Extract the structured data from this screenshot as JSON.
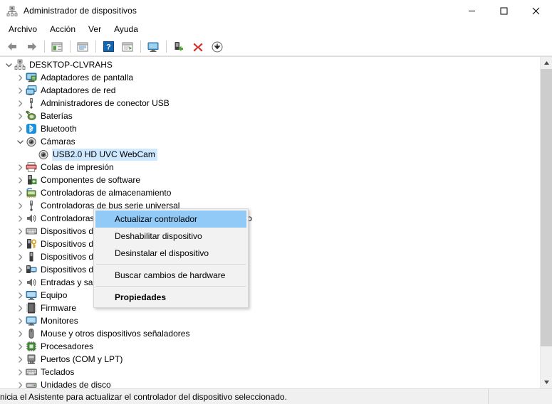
{
  "window": {
    "title": "Administrador de dispositivos",
    "icon": "device-manager-icon",
    "controls": {
      "minimize": "─",
      "maximize": "□",
      "close": "✕"
    }
  },
  "menubar": {
    "items": [
      {
        "label": "Archivo",
        "name": "menu-archivo"
      },
      {
        "label": "Acción",
        "name": "menu-accion"
      },
      {
        "label": "Ver",
        "name": "menu-ver"
      },
      {
        "label": "Ayuda",
        "name": "menu-ayuda"
      }
    ]
  },
  "toolbar": {
    "buttons": [
      {
        "icon": "back-arrow-icon",
        "glyph": "←"
      },
      {
        "icon": "forward-arrow-icon",
        "glyph": "→"
      },
      {
        "icon": "show-hide-console-tree-icon",
        "glyph": "▤"
      },
      {
        "icon": "properties-icon",
        "glyph": "▦"
      },
      {
        "icon": "help-icon",
        "glyph": "?"
      },
      {
        "icon": "update-driver-icon",
        "glyph": "▶"
      },
      {
        "icon": "scan-hardware-changes-icon",
        "glyph": "⬜"
      },
      {
        "icon": "enable-device-icon",
        "glyph": "↑"
      },
      {
        "icon": "uninstall-device-icon",
        "glyph": "✕"
      },
      {
        "icon": "install-legacy-hardware-icon",
        "glyph": "↓"
      }
    ]
  },
  "tree": {
    "root": {
      "label": "DESKTOP-CLVRAHS",
      "icon": "computer-icon",
      "expanded": true
    },
    "nodes": [
      {
        "label": "Adaptadores de pantalla",
        "icon": "display-adapter-icon",
        "expanded": false,
        "level": 1
      },
      {
        "label": "Adaptadores de red",
        "icon": "network-adapter-icon",
        "expanded": false,
        "level": 1
      },
      {
        "label": "Administradores de conector USB",
        "icon": "usb-connector-icon",
        "expanded": false,
        "level": 1
      },
      {
        "label": "Baterías",
        "icon": "battery-icon",
        "expanded": false,
        "level": 1
      },
      {
        "label": "Bluetooth",
        "icon": "bluetooth-icon",
        "expanded": false,
        "level": 1
      },
      {
        "label": "Cámaras",
        "icon": "camera-icon",
        "expanded": true,
        "level": 1
      },
      {
        "label": "USB2.0 HD UVC WebCam",
        "icon": "camera-device-icon",
        "expanded": null,
        "level": 2,
        "selected": true
      },
      {
        "label": "Colas de impresión",
        "icon": "print-queue-icon",
        "expanded": false,
        "level": 1
      },
      {
        "label": "Componentes de software",
        "icon": "software-component-icon",
        "expanded": false,
        "level": 1
      },
      {
        "label": "Controladoras de almacenamiento",
        "icon": "storage-controller-icon",
        "expanded": false,
        "level": 1
      },
      {
        "label": "Controladoras de bus serie universal",
        "icon": "usb-controller-icon",
        "expanded": false,
        "level": 1
      },
      {
        "label": "Controladoras de sonido y vídeo y dispositivos de juego",
        "icon": "sound-controller-icon",
        "expanded": false,
        "level": 1
      },
      {
        "label": "Dispositivos de interfaz de usuario",
        "icon": "hid-icon",
        "expanded": false,
        "level": 1
      },
      {
        "label": "Dispositivos de seguridad",
        "icon": "security-device-icon",
        "expanded": false,
        "level": 1
      },
      {
        "label": "Dispositivos de software",
        "icon": "software-device-icon",
        "expanded": false,
        "level": 1
      },
      {
        "label": "Dispositivos del sistema",
        "icon": "system-device-icon",
        "expanded": false,
        "level": 1
      },
      {
        "label": "Entradas y salidas de audio",
        "icon": "audio-io-icon",
        "expanded": false,
        "level": 1
      },
      {
        "label": "Equipo",
        "icon": "computer-device-icon",
        "expanded": false,
        "level": 1
      },
      {
        "label": "Firmware",
        "icon": "firmware-icon",
        "expanded": false,
        "level": 1
      },
      {
        "label": "Monitores",
        "icon": "monitor-icon",
        "expanded": false,
        "level": 1
      },
      {
        "label": "Mouse y otros dispositivos señaladores",
        "icon": "mouse-icon",
        "expanded": false,
        "level": 1
      },
      {
        "label": "Procesadores",
        "icon": "processor-icon",
        "expanded": false,
        "level": 1
      },
      {
        "label": "Puertos (COM y LPT)",
        "icon": "port-icon",
        "expanded": false,
        "level": 1
      },
      {
        "label": "Teclados",
        "icon": "keyboard-icon",
        "expanded": false,
        "level": 1
      },
      {
        "label": "Unidades de disco",
        "icon": "disk-drive-icon",
        "expanded": false,
        "level": 1
      }
    ]
  },
  "context_menu": {
    "items": [
      {
        "label": "Actualizar controlador",
        "name": "ctx-actualizar-controlador",
        "highlighted": true,
        "bold": false
      },
      {
        "label": "Deshabilitar dispositivo",
        "name": "ctx-deshabilitar-dispositivo",
        "highlighted": false,
        "bold": false
      },
      {
        "label": "Desinstalar el dispositivo",
        "name": "ctx-desinstalar-dispositivo",
        "highlighted": false,
        "bold": false
      },
      {
        "separator": true
      },
      {
        "label": "Buscar cambios de hardware",
        "name": "ctx-buscar-cambios-hardware",
        "highlighted": false,
        "bold": false
      },
      {
        "separator": true
      },
      {
        "label": "Propiedades",
        "name": "ctx-propiedades",
        "highlighted": false,
        "bold": true
      }
    ]
  },
  "statusbar": {
    "text": "nicia el Asistente para actualizar el controlador del dispositivo seleccionado."
  },
  "scrollbar": {
    "up_glyph": "⌃",
    "down_glyph": "⌄"
  },
  "colors": {
    "selection": "#cde8ff",
    "menu_highlight": "#91c9f7",
    "chrome": "#f0f0f0",
    "accent_red": "#d42b27",
    "accent_green": "#3f9a2f",
    "accent_blue": "#0a6cc4"
  }
}
